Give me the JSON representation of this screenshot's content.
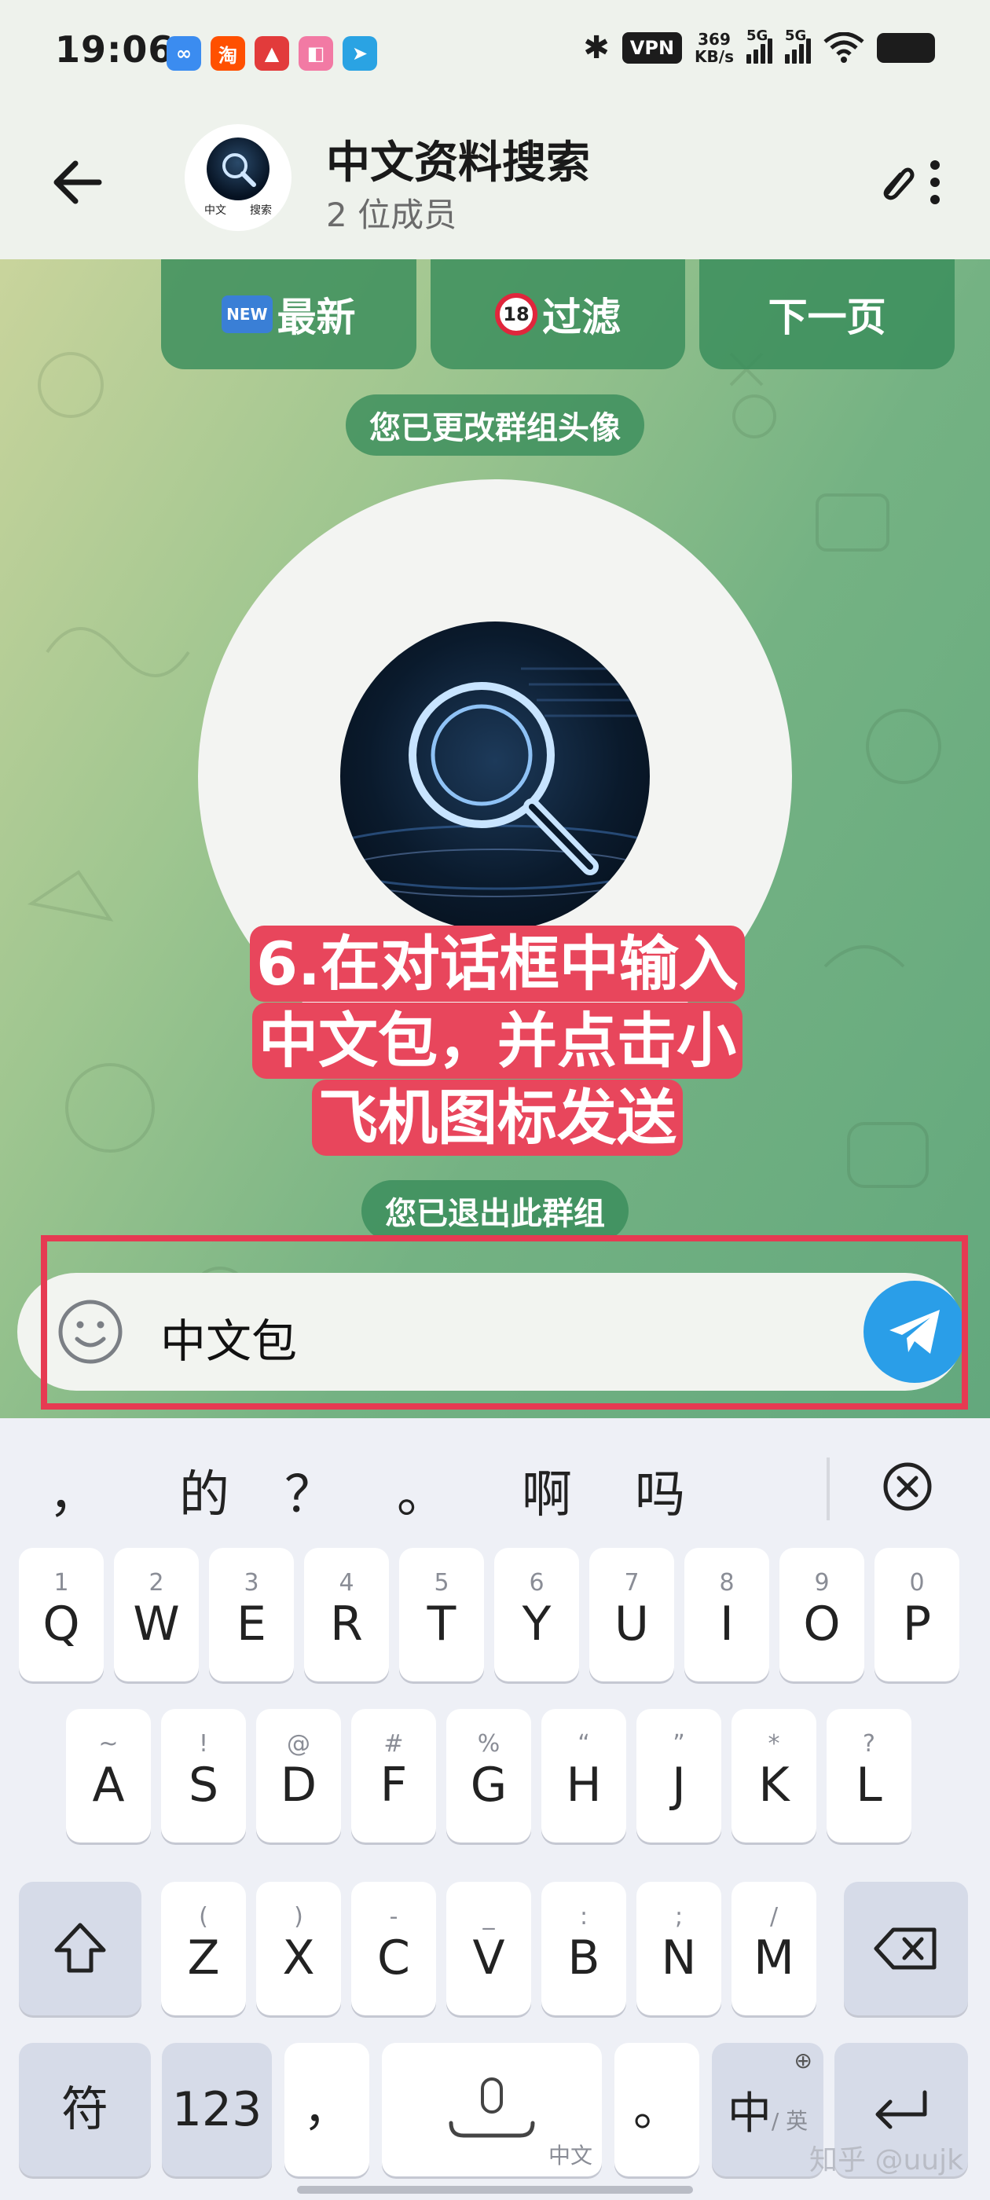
{
  "status_bar": {
    "time": "19:06",
    "app_icons": [
      {
        "name": "baidu-netdisk-icon",
        "glyph": "∞",
        "color": "#3b8cf0"
      },
      {
        "name": "taobao-icon",
        "glyph": "淘",
        "color": "#ff5000"
      },
      {
        "name": "shopping-app-icon",
        "glyph": "▲",
        "color": "#e23b3b"
      },
      {
        "name": "bilibili-icon",
        "glyph": "◧",
        "color": "#f27aa4"
      },
      {
        "name": "telegram-icon",
        "glyph": "➤",
        "color": "#2aa3e3"
      }
    ],
    "vpn_label": "VPN",
    "net_speed_value": "369",
    "net_speed_unit": "KB/s",
    "signal1_label": "5G",
    "signal2_label": "5G"
  },
  "header": {
    "title": "中文资料搜索",
    "subtitle": "2 位成员",
    "avatar_label_left": "中文",
    "avatar_label_right": "搜索"
  },
  "bot_buttons": {
    "latest_label": "最新",
    "latest_emoji": "NEW",
    "filter_label": "过滤",
    "filter_emoji": "18",
    "next_label": "下一页"
  },
  "messages": {
    "service_changed_avatar": "您已更改群组头像",
    "service_left_group": "您已退出此群组"
  },
  "annotation": {
    "line1": "6.在对话框中输入",
    "line2": "中文包，并点击小",
    "line3": "飞机图标发送"
  },
  "input": {
    "value": "中文包"
  },
  "keyboard": {
    "candidates": [
      "，",
      "的",
      "？",
      "。",
      "啊",
      "吗"
    ],
    "row1": [
      {
        "main": "Q",
        "sub": "1"
      },
      {
        "main": "W",
        "sub": "2"
      },
      {
        "main": "E",
        "sub": "3"
      },
      {
        "main": "R",
        "sub": "4"
      },
      {
        "main": "T",
        "sub": "5"
      },
      {
        "main": "Y",
        "sub": "6"
      },
      {
        "main": "U",
        "sub": "7"
      },
      {
        "main": "I",
        "sub": "8"
      },
      {
        "main": "O",
        "sub": "9"
      },
      {
        "main": "P",
        "sub": "0"
      }
    ],
    "row2": [
      {
        "main": "A",
        "sub": "~"
      },
      {
        "main": "S",
        "sub": "!"
      },
      {
        "main": "D",
        "sub": "@"
      },
      {
        "main": "F",
        "sub": "#"
      },
      {
        "main": "G",
        "sub": "%"
      },
      {
        "main": "H",
        "sub": "“"
      },
      {
        "main": "J",
        "sub": "”"
      },
      {
        "main": "K",
        "sub": "*"
      },
      {
        "main": "L",
        "sub": "?"
      }
    ],
    "row3": [
      {
        "main": "Z",
        "sub": "("
      },
      {
        "main": "X",
        "sub": ")"
      },
      {
        "main": "C",
        "sub": "-"
      },
      {
        "main": "V",
        "sub": "_"
      },
      {
        "main": "B",
        "sub": ":"
      },
      {
        "main": "N",
        "sub": ";"
      },
      {
        "main": "M",
        "sub": "/"
      }
    ],
    "symbols_label": "符",
    "numbers_label": "123",
    "comma_label": "，",
    "space_label": "中文",
    "period_label": "。",
    "lang_main": "中",
    "lang_sub": "/ 英"
  },
  "watermark": "知乎 @uujk",
  "colors": {
    "accent_green": "#388c5a",
    "annotation_red": "#e8465c",
    "send_blue": "#2a9ee8",
    "highlight_border": "#e63a52"
  }
}
